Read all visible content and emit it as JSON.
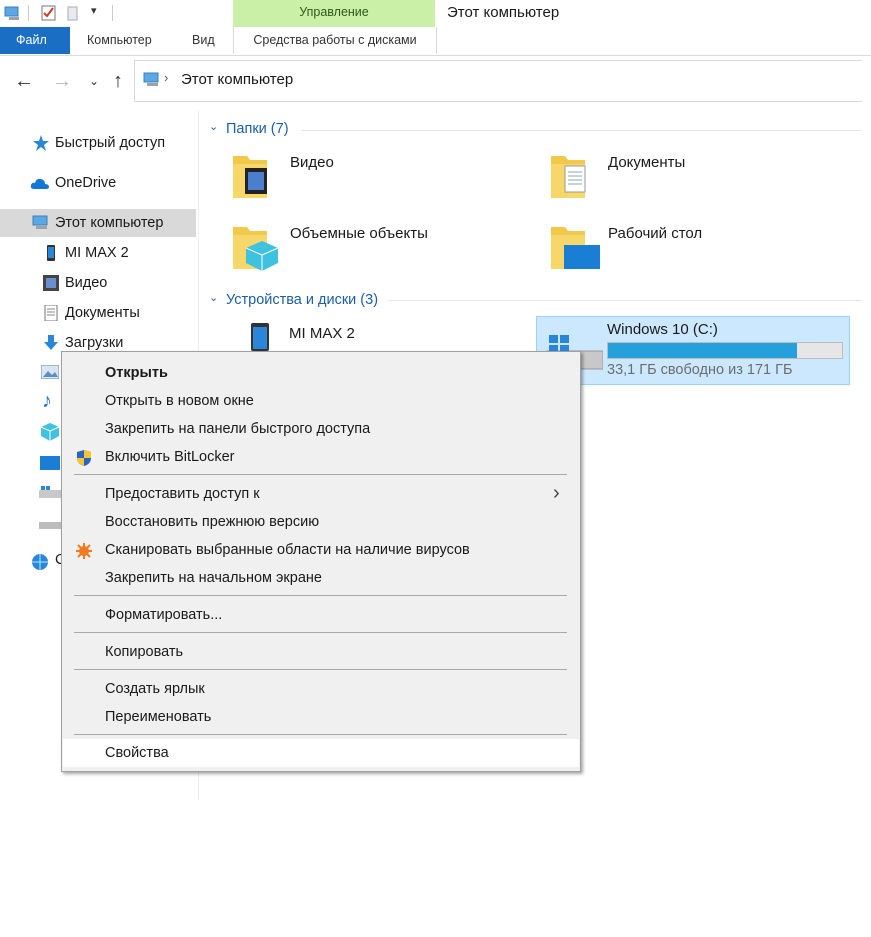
{
  "window": {
    "title": "Этот компьютер",
    "context_tab_group": "Управление"
  },
  "ribbon": {
    "tabs": [
      "Файл",
      "Компьютер",
      "Вид",
      "Средства работы с дисками"
    ]
  },
  "address": {
    "path": "Этот компьютер"
  },
  "sidebar": {
    "items": [
      {
        "label": "Быстрый доступ",
        "icon": "star-icon"
      },
      {
        "label": "OneDrive",
        "icon": "cloud-icon"
      },
      {
        "label": "Этот компьютер",
        "icon": "computer-icon",
        "selected": true
      },
      {
        "label": "MI MAX 2",
        "icon": "phone-icon"
      },
      {
        "label": "Видео",
        "icon": "video-icon"
      },
      {
        "label": "Документы",
        "icon": "documents-icon"
      },
      {
        "label": "Загрузки",
        "icon": "download-icon"
      }
    ],
    "partial_label": "С"
  },
  "content": {
    "folders_header": "Папки (7)",
    "folders": [
      "Видео",
      "Документы",
      "Объемные объекты",
      "Рабочий стол"
    ],
    "devices_header": "Устройства и диски (3)",
    "device_phone": "MI MAX 2",
    "drive": {
      "name": "Windows 10 (C:)",
      "free_text": "33,1 ГБ свободно из 171 ГБ",
      "used_fraction": 0.806
    }
  },
  "context_menu": {
    "items": [
      "Открыть",
      "Открыть в новом окне",
      "Закрепить на панели быстрого доступа",
      "Включить BitLocker",
      "Предоставить доступ к",
      "Восстановить прежнюю версию",
      "Сканировать выбранные области на наличие вирусов",
      "Закрепить на начальном экране",
      "Форматировать...",
      "Копировать",
      "Создать ярлык",
      "Переименовать",
      "Свойства"
    ],
    "submenu_arrow": "›"
  },
  "colors": {
    "accent": "#1a6fc4",
    "context_tab": "#c9f0a6",
    "selection": "#cce8ff",
    "drive_fill": "#26a0da",
    "group_header": "#1c5ea8"
  }
}
